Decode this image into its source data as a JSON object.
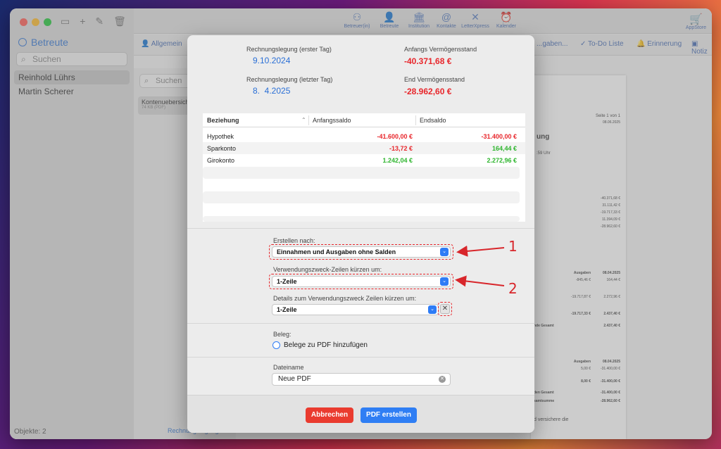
{
  "sidebar": {
    "title": "Betreute",
    "search_placeholder": "Suchen",
    "items": [
      {
        "label": "Reinhold Lührs"
      },
      {
        "label": "Martin Scherer"
      }
    ],
    "footer": "Objekte: 2"
  },
  "toolbar": {
    "buttons": [
      {
        "label": "Betreuer(in)",
        "icon": "people-icon"
      },
      {
        "label": "Betreute",
        "icon": "person-icon"
      },
      {
        "label": "Institution",
        "icon": "bank-icon"
      },
      {
        "label": "Kontakte",
        "icon": "at-icon"
      },
      {
        "label": "LetterXpress",
        "icon": "letter-icon"
      },
      {
        "label": "Kalender",
        "icon": "clock-icon"
      }
    ],
    "appstore": "AppStore"
  },
  "section_bar": {
    "allgemein": "Allgemein",
    "ausgaben": "...gaben...",
    "todo": "To-Do Liste",
    "erinnerung": "Erinnerung",
    "notiz": "Notiz"
  },
  "middle": {
    "search_placeholder": "Suchen",
    "doc_title": "Kontenuebersicht",
    "doc_size": "74 KB (PDF)",
    "footer": "Rechnungslegung"
  },
  "preview": {
    "page": "Seite 1 von 1",
    "date": "08.06.2025",
    "heading": "ung",
    "time": ":59 Uhr",
    "values": [
      "-40.371,68 €",
      "31.111,42 €",
      "-19.717,33 €",
      "11.394,09 €",
      "-28.962,60 €"
    ],
    "col_ausgaben": "Ausgaben",
    "col_date": "08.04.2025",
    "rows1": [
      [
        "-845,46 €",
        "164,44 €"
      ],
      [
        "-19.717,87 €",
        "2.272,96 €"
      ],
      [
        "-19.717,33 €",
        "2.437,40 €"
      ]
    ],
    "gesamt_label": "nde Gesamt",
    "gesamt_value": "2.437,40 €",
    "rows2": [
      [
        "5,00 €",
        "-31.400,00 €"
      ],
      [
        "8,00 €",
        "-31.400,00 €"
      ]
    ],
    "den_gesamt": "den Gesamt",
    "den_gesamt_val": "-31.400,00 €",
    "summe": "samtsumme",
    "summe_val": "-28.962,60 €",
    "versichere": "d versichere die"
  },
  "dialog": {
    "first_day_label": "Rechnungslegung (erster Tag)",
    "first_day": "9.10.2024",
    "last_day_label": "Rechnungslegung (letzter Tag)",
    "last_day": "8.  4.2025",
    "start_label": "Anfangs Vermögensstand",
    "start_value": "-40.371,68 €",
    "end_label": "End Vermögensstand",
    "end_value": "-28.962,60 €",
    "table": {
      "headers": [
        "Beziehung",
        "Anfangssaldo",
        "Endsaldo"
      ],
      "rows": [
        {
          "name": "Hypothek",
          "start": "-41.600,00 €",
          "end": "-31.400,00 €"
        },
        {
          "name": "Sparkonto",
          "start": "-13,72 €",
          "end": "164,44 €"
        },
        {
          "name": "Girokonto",
          "start": "1.242,04 €",
          "end": "2.272,96 €"
        }
      ]
    },
    "create_by_label": "Erstellen nach:",
    "create_by_value": "Einnahmen und Ausgaben ohne Salden",
    "purpose_label": "Verwendungszweck-Zeilen kürzen um:",
    "purpose_value": "1-Zeile",
    "details_label": "Details zum Verwendungszweck Zeilen kürzen um:",
    "details_value": "1-Zeile",
    "beleg_label": "Beleg:",
    "beleg_option": "Belege zu PDF hinzufügen",
    "filename_label": "Dateiname",
    "filename_value": "Neue PDF",
    "cancel": "Abbrechen",
    "create": "PDF erstellen"
  },
  "annotations": {
    "one": "1",
    "two": "2"
  },
  "colors": {
    "accent": "#2e7cf6",
    "negative": "#e8262b",
    "positive": "#2db52d",
    "cancel": "#ea3b2f"
  }
}
